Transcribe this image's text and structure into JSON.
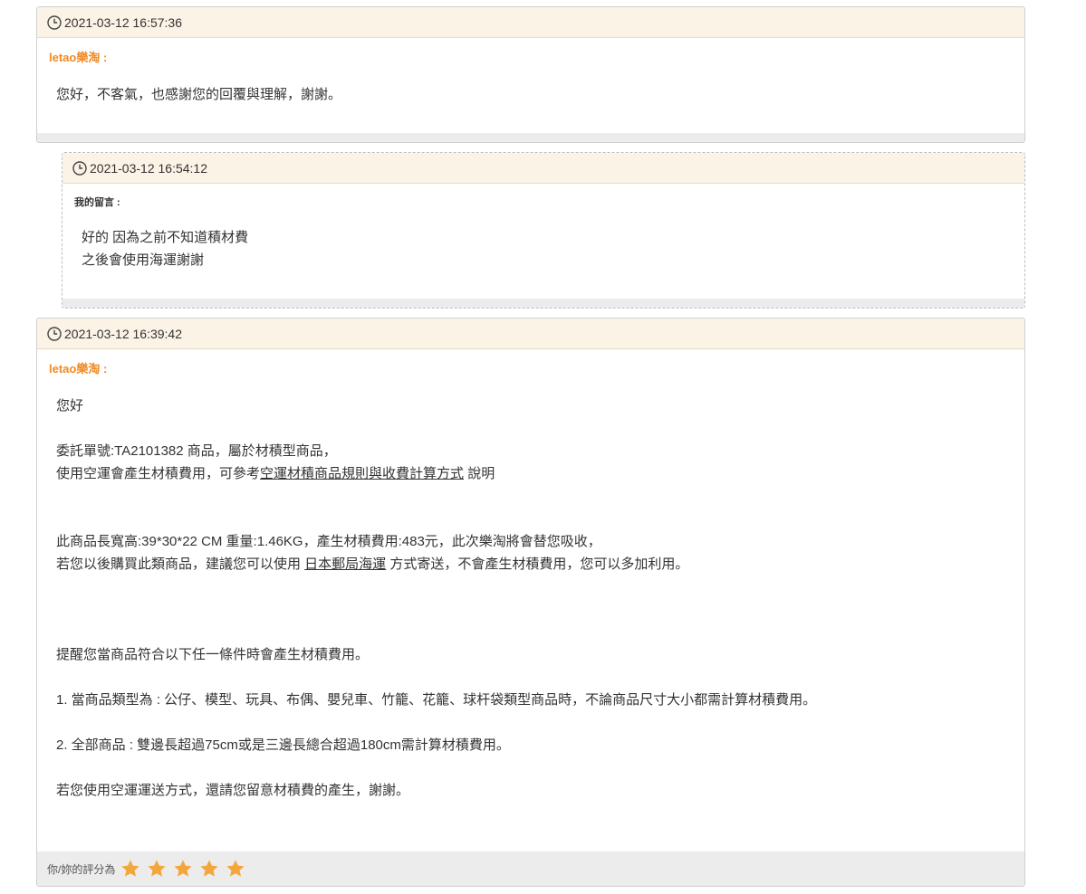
{
  "messages": [
    {
      "time": "2021-03-12 16:57:36",
      "author": "letao樂淘 :",
      "lines": [
        "您好，不客氣，也感謝您的回覆與理解，謝謝。"
      ]
    },
    {
      "time": "2021-03-12 16:54:12",
      "author": "我的留言 :",
      "lines": [
        "好的 因為之前不知道積材費",
        "之後會使用海運謝謝"
      ]
    },
    {
      "time": "2021-03-12 16:39:42",
      "author": "letao樂淘 :",
      "greeting": "您好",
      "order_line": "委託單號:TA2101382 商品，屬於材積型商品，",
      "air_prefix": "使用空運會產生材積費用，可參考",
      "air_link": "空運材積商品規則與收費計算方式",
      "air_suffix": " 說明",
      "size_line": "此商品長寬高:39*30*22 CM 重量:1.46KG，產生材積費用:483元，此次樂淘將會替您吸收，",
      "suggest_prefix": "若您以後購買此類商品，建議您可以使用 ",
      "suggest_link": "日本郵局海運",
      "suggest_suffix": " 方式寄送，不會產生材積費用，您可以多加利用。",
      "reminder": "提醒您當商品符合以下任一條件時會產生材積費用。",
      "rule1": "1. 當商品類型為 : 公仔、模型、玩具、布偶、嬰兒車、竹籠、花籠、球杆袋類型商品時，不論商品尺寸大小都需計算材積費用。",
      "rule2": "2. 全部商品 : 雙邊長超過75cm或是三邊長總合超過180cm需計算材積費用。",
      "closing": "若您使用空運運送方式，還請您留意材積費的產生，謝謝。",
      "rating_label": "你/妳的評分為",
      "rating_value": 5,
      "rating_max": 5
    }
  ],
  "colors": {
    "header_bg": "#fbf3e6",
    "author_accent": "#f08a24",
    "star": "#f3a73b",
    "footer_bg": "#ececec"
  },
  "icons": {
    "timestamp": "clock-icon",
    "rating": "star-icon"
  }
}
